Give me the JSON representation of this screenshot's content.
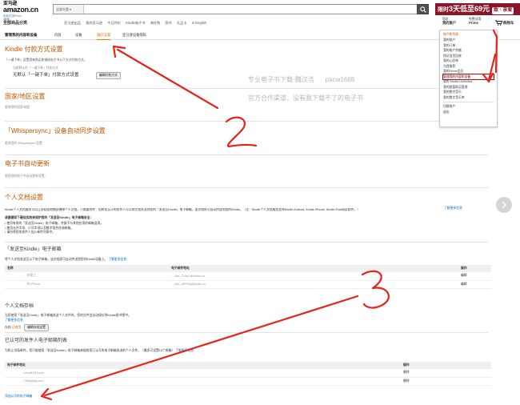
{
  "header": {
    "logo_main": "亚马逊",
    "logo_sub": "amazon.cn",
    "logo_tag": "免费试用Prime",
    "search_category": "全部分类",
    "search_placeholder": "",
    "promo_prefix": "限时",
    "promo_big": "3天低至69元",
    "promo_pill": "致 · 亲爱"
  },
  "nav": {
    "shop_top": "浏览",
    "shop_bottom": "全部商品分类",
    "links": [
      "亚马逊出品",
      "我的亚马逊",
      "今日特价",
      "Kindle电子书",
      "海外购",
      "图书",
      "礼品卡",
      "In English"
    ],
    "account_top": "您好,",
    "account_bottom": "我的账户",
    "prime_top": "免费试用",
    "prime_bottom": "Prime",
    "cart": "购物车"
  },
  "subnav": {
    "title": "管理我的内容和设备",
    "tabs": [
      "内容",
      "设备",
      "偏好设置",
      "亚马逊设备隐私"
    ]
  },
  "dropdown": {
    "title": "账户和列表",
    "items_a": [
      "我的账户",
      "我的订单",
      "我的账户余额",
      "保证旧货回收",
      "我的心愿单",
      "为我推荐",
      "我的Prime会员",
      "管理我的内容和设备",
      "我的 Kindle Unlimited",
      "我的超值购买管理",
      "我的数字音乐",
      "我的数字音乐库"
    ],
    "items_b": [
      "切换账户",
      "退出"
    ],
    "highlight_index": 7
  },
  "sections": {
    "kindle_pay_title": "Kindle 付款方式设置",
    "kindle_pay_desc": "「一键下单」设置用来购买和借阅电子书以下方式付款方式。",
    "kindle_pay_current_label": "当前默认的「一键下单」付款方式",
    "kindle_pay_current_value": "无默认「一键下单」付款方式设置",
    "kindle_pay_button": "编辑付款方式",
    "region_title": "国家/地区设置",
    "region_desc": "更改您的国家/地区",
    "whisper_title": "「Whispersync」设备自动同步设置",
    "whisper_desc": "更改您的 Whispersync 设置",
    "ebook_update_title": "电子书自动更新",
    "ebook_update_desc": "更改您的电子书自动更新设置。",
    "personal_title": "个人文档设置",
    "personal_desc": "Kindle个人文档服务可以让您轻松地随身携带个人文档。只需要附件、您和您认可的发件人可以将文档发送到您的「发送至Kindle」电子邮箱，该文档将可自动传送到您的Kindle。（注：Kindle个人文档服务支持Kindle Android, Kindle iPhone, Kindle iPad阅读软件。）",
    "personal_desc_link": "了解更多信息",
    "safety_title": "请遵循如下最佳实践来保护您的「发送至Kindle」电子邮箱安全：",
    "safety_items": [
      "使用有效的「发送至Kindle」电子邮箱，并量不与其他应用的邮箱混用。",
      "使用允许字母、小写字母以及数字组合合成邮箱。",
      "请勿将您的发件人加入邮件列表中。"
    ],
    "send_title": "「发送至Kindle」电子邮箱",
    "send_desc": "将个人文档发送至以下电子邮箱，该文档即可自动传送到您的Kindle设备上。",
    "send_link": "了解更多信息",
    "send_headers": [
      "名称",
      "电子邮件地址",
      "操作"
    ],
    "send_rows": [
      {
        "name": "…的第三",
        "email": "…cfcs_TUrpL@kindle.cn",
        "action": "编辑"
      },
      {
        "name": "…的 iPhone",
        "email": "…cfcs_aRF9s@kindle.cn",
        "action": "编辑"
      }
    ],
    "storage_title": "个人文档存档",
    "storage_desc": "当您使用「发送至Kindle」电子邮箱发送个人文件时，您的文件会自动保存到Kindle图书馆中。",
    "storage_link": "了解更多信息",
    "storage_status_label": "存档",
    "storage_status": "已启用",
    "storage_button": "编辑存档设置",
    "approved_title": "已认可的发件人电子邮箱列表",
    "approved_desc": "为防止垃圾邮件，您只能使用「发送至Kindle」电子邮箱来接收您已认可的电子邮箱发送的个人文件。（最多可设置15个邮箱）",
    "approved_link": "了解更多信息",
    "approved_headers": [
      "电子邮件地址",
      "操作"
    ],
    "approved_rows": [
      {
        "email": "…ofcs@163.com",
        "action": "删除"
      },
      {
        "email": "…766a@qq.com",
        "action": "删除"
      }
    ],
    "add_approved": "添加认可的电子邮箱"
  },
  "watermark": {
    "line1": "专业电子书下载-魏汉浩",
    "line1b": "pacw1688",
    "line2": "官方合作渠道，没有我下载不了的电子书"
  },
  "colors": {
    "accent": "#c45500",
    "link": "#0066c0",
    "promo": "#8b1428",
    "annotation": "#e8221a"
  },
  "annotations": [
    "1",
    "2",
    "3"
  ]
}
